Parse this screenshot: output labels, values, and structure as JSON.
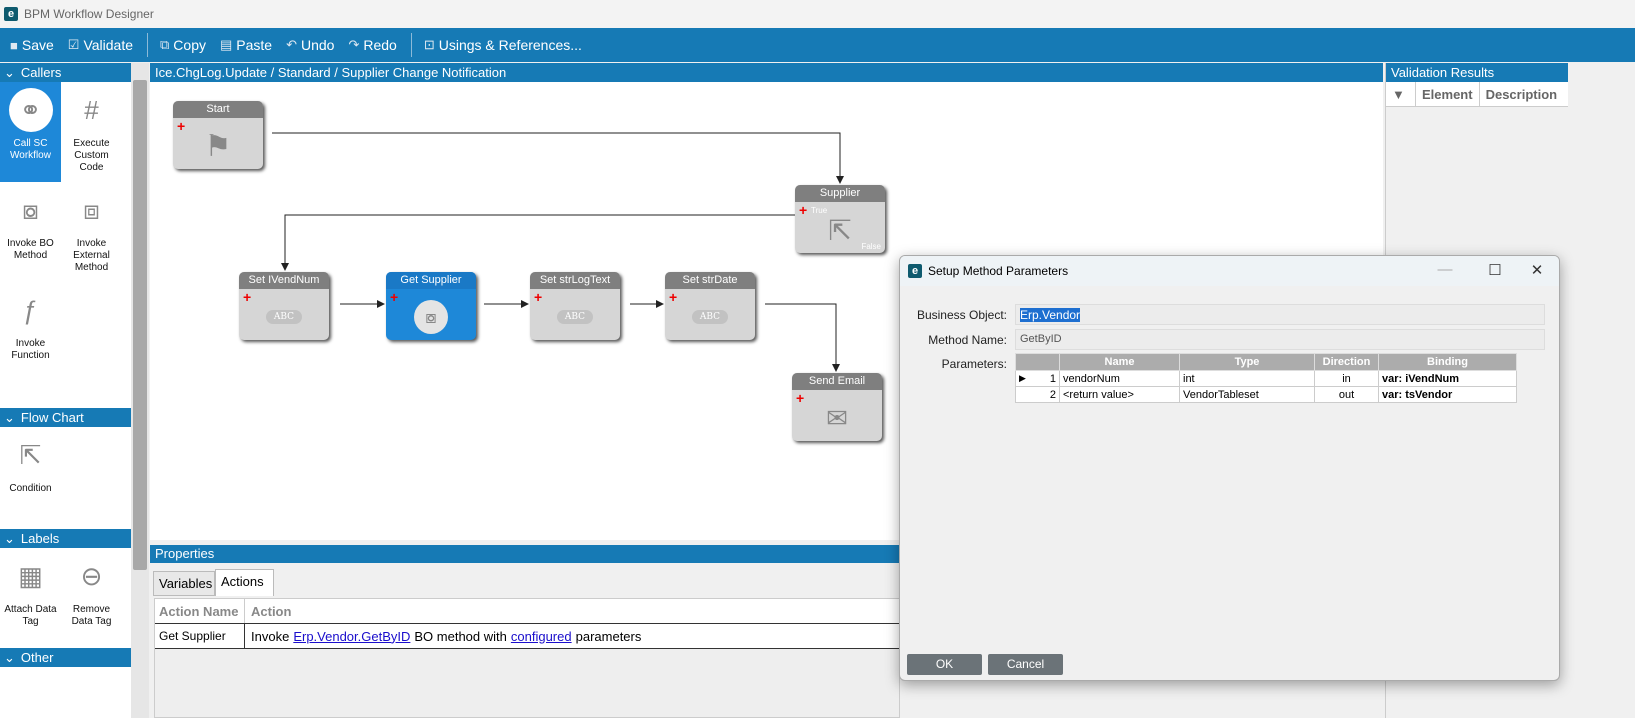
{
  "window": {
    "title": "BPM Workflow Designer",
    "logo": "e"
  },
  "toolbar": [
    {
      "label": "Save",
      "icon": "save-icon"
    },
    {
      "label": "Validate",
      "icon": "check-icon"
    },
    {
      "label": "Copy",
      "icon": "copy-icon"
    },
    {
      "label": "Paste",
      "icon": "paste-icon"
    },
    {
      "label": "Undo",
      "icon": "undo-icon"
    },
    {
      "label": "Redo",
      "icon": "redo-icon"
    },
    {
      "label": "Usings & References...",
      "icon": "references-icon"
    }
  ],
  "palette": {
    "callers": {
      "title": "Callers",
      "items": [
        "Call SC Workflow",
        "Execute Custom Code",
        "Invoke BO Method",
        "Invoke External Method",
        "Invoke Function"
      ]
    },
    "flowchart": {
      "title": "Flow Chart",
      "items": [
        "Condition"
      ]
    },
    "labels": {
      "title": "Labels",
      "items": [
        "Attach Data Tag",
        "Remove Data Tag"
      ]
    },
    "other": {
      "title": "Other"
    }
  },
  "canvas": {
    "breadcrumb": "Ice.ChgLog.Update / Standard / Supplier Change Notification",
    "nodes": {
      "start": "Start",
      "supplier": "Supplier",
      "true_label": "True",
      "false_label": "False",
      "set_ivendnum": "Set IVendNum",
      "get_supplier": "Get Supplier",
      "set_strlogtext": "Set strLogText",
      "set_strdate": "Set strDate",
      "send_email": "Send Email",
      "abc": "ABC"
    }
  },
  "properties": {
    "title": "Properties",
    "tabs": [
      "Variables",
      "Actions"
    ],
    "active_tab": "Actions",
    "columns": [
      "Action Name",
      "Action"
    ],
    "row": {
      "name": "Get Supplier",
      "pre": "Invoke",
      "link1": "Erp.Vendor.GetByID",
      "mid": "BO method with",
      "link2": "configured",
      "post": "parameters"
    }
  },
  "validation": {
    "title": "Validation Results",
    "columns": [
      "Element",
      "Description"
    ]
  },
  "dialog": {
    "title": "Setup Method Parameters",
    "business_object_label": "Business Object:",
    "business_object": "Erp.Vendor",
    "method_label": "Method Name:",
    "method": "GetByID",
    "params_label": "Parameters:",
    "columns": [
      "Name",
      "Type",
      "Direction",
      "Binding"
    ],
    "rows": [
      {
        "n": "1",
        "name": "vendorNum",
        "type": "int",
        "dir": "in",
        "binding": "var: iVendNum"
      },
      {
        "n": "2",
        "name": "<return value>",
        "type": "VendorTableset",
        "dir": "out",
        "binding": "var: tsVendor"
      }
    ],
    "ok": "OK",
    "cancel": "Cancel"
  }
}
